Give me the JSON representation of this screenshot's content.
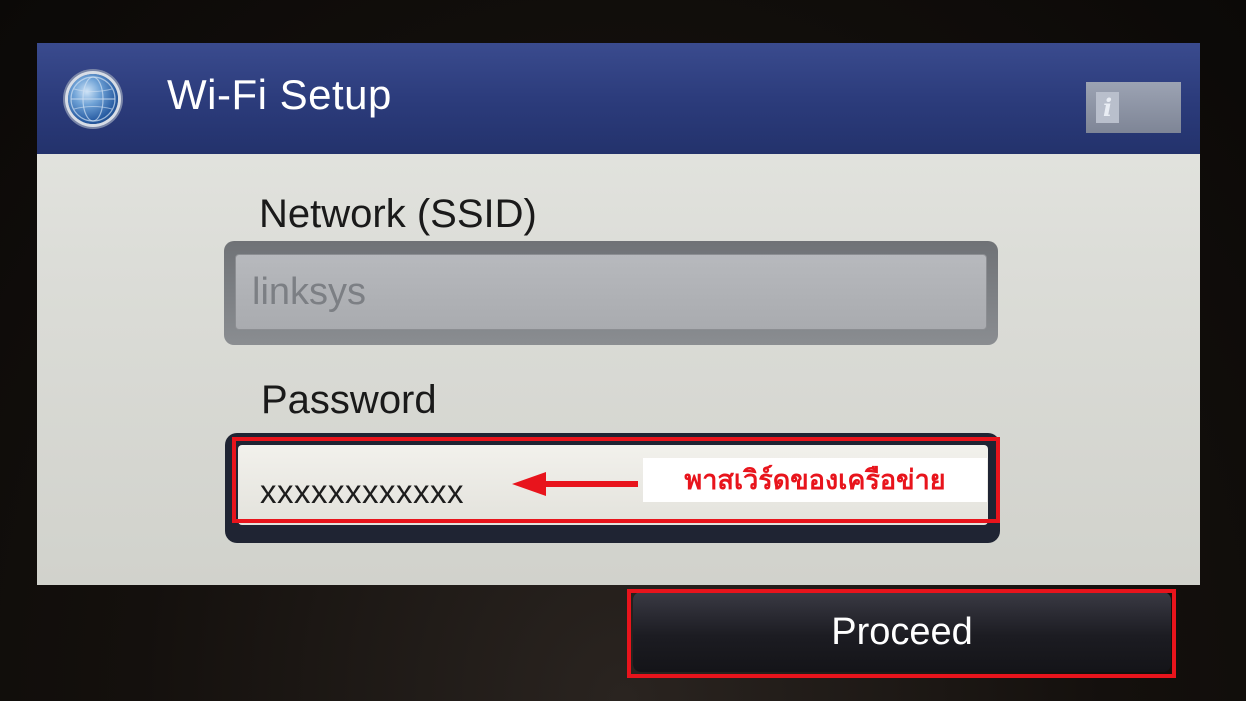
{
  "header": {
    "title": "Wi-Fi Setup",
    "info_label": "i",
    "icon": "globe-icon"
  },
  "network": {
    "label": "Network (SSID)",
    "value": "linksys"
  },
  "password": {
    "label": "Password",
    "value": "xxxxxxxxxxxx",
    "annotation": "พาสเวิร์ดของเครือข่าย"
  },
  "actions": {
    "proceed_label": "Proceed"
  },
  "colors": {
    "titlebar": "#2c3c7c",
    "highlight": "#e8141c",
    "screen": "#dcddd8"
  }
}
